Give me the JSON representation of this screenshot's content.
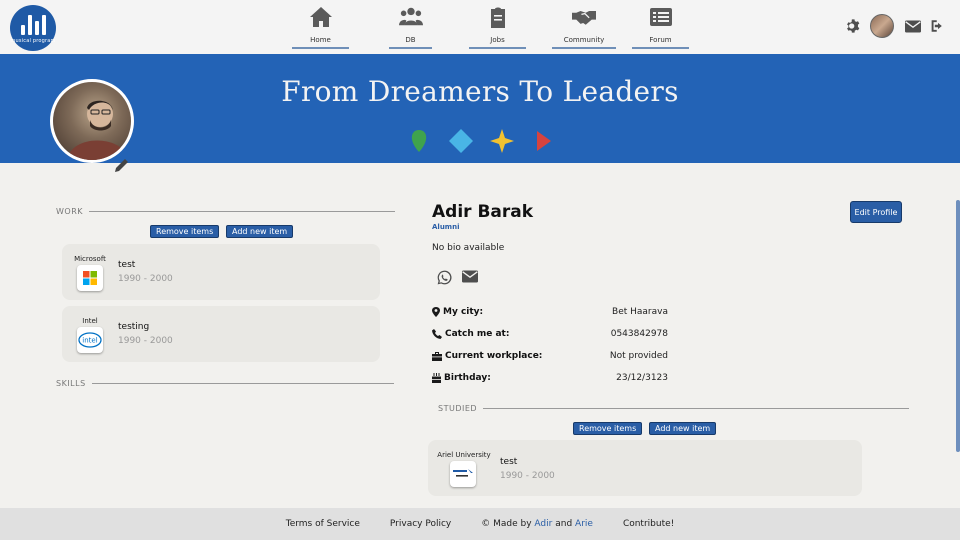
{
  "app": {
    "logo_text": "musical program"
  },
  "nav": {
    "items": [
      {
        "label": "Home",
        "icon": "home-icon"
      },
      {
        "label": "DB",
        "icon": "users-icon"
      },
      {
        "label": "Jobs",
        "icon": "clipboard-icon"
      },
      {
        "label": "Community",
        "icon": "handshake-icon"
      },
      {
        "label": "Forum",
        "icon": "list-icon"
      }
    ]
  },
  "header_icons": [
    "gear-icon",
    "avatar",
    "mail-icon",
    "logout-icon"
  ],
  "banner": {
    "title": "From Dreamers To Leaders",
    "background": "#2363b6",
    "shape_colors": [
      "#3fa34d",
      "#49b5e6",
      "#f2c230",
      "#d6433f"
    ]
  },
  "work": {
    "heading": "WORK",
    "remove_label": "Remove items",
    "add_label": "Add new item",
    "items": [
      {
        "company": "Microsoft",
        "title": "test",
        "years": "1990 - 2000"
      },
      {
        "company": "Intel",
        "title": "testing",
        "years": "1990 - 2000"
      }
    ]
  },
  "skills": {
    "heading": "SKILLS"
  },
  "profile": {
    "name": "Adir Barak",
    "role": "Alumni",
    "bio": "No bio available",
    "edit_label": "Edit Profile",
    "fields": [
      {
        "label": "My city:",
        "value": "Bet Haarava",
        "icon": "location-pin-icon"
      },
      {
        "label": "Catch me at:",
        "value": "0543842978",
        "icon": "phone-icon"
      },
      {
        "label": "Current workplace:",
        "value": "Not provided",
        "icon": "briefcase-icon"
      },
      {
        "label": "Birthday:",
        "value": "23/12/3123",
        "icon": "cake-icon"
      }
    ]
  },
  "studied": {
    "heading": "STUDIED",
    "remove_label": "Remove items",
    "add_label": "Add new item",
    "items": [
      {
        "institution": "Ariel University",
        "title": "test",
        "years": "1990 - 2000"
      }
    ]
  },
  "footer": {
    "terms": "Terms of Service",
    "privacy": "Privacy Policy",
    "made_by_prefix": "© Made by",
    "author1": "Adir",
    "and": "and",
    "author2": "Arie",
    "contribute": "Contribute!"
  },
  "colors": {
    "accent": "#2a5ea6"
  }
}
